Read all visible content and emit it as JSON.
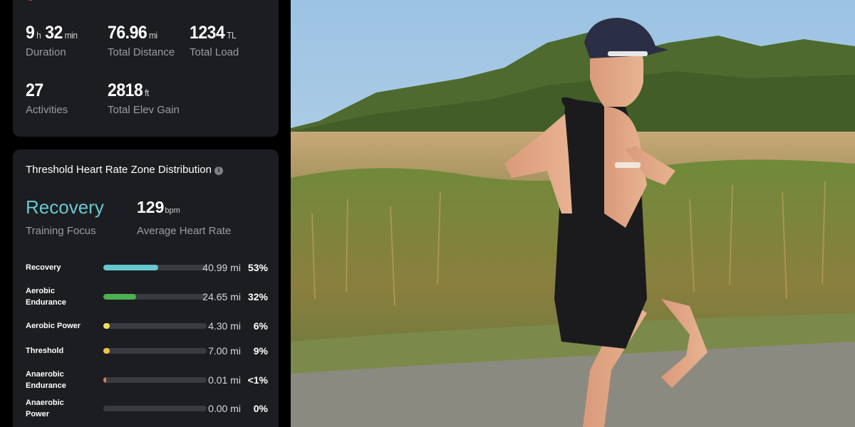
{
  "summary": {
    "duration": {
      "hours": "9",
      "h_unit": "h",
      "minutes": "32",
      "min_unit": "min",
      "label": "Duration"
    },
    "distance": {
      "value": "76.96",
      "unit": "mi",
      "label": "Total Distance"
    },
    "load": {
      "value": "1234",
      "unit": "TL",
      "label": "Total Load"
    },
    "activities": {
      "value": "27",
      "label": "Activities"
    },
    "elevation": {
      "value": "2818",
      "unit": "ft",
      "label": "Total Elev Gain"
    }
  },
  "zones": {
    "title": "Threshold Heart Rate Zone Distribution",
    "info_icon": "info-icon",
    "training_focus": {
      "value": "Recovery",
      "label": "Training Focus"
    },
    "avg_hr": {
      "value": "129",
      "unit": "bpm",
      "label": "Average Heart Rate"
    },
    "rows": [
      {
        "name": "Recovery",
        "distance": "40.99 mi",
        "percent": "53%",
        "fill": 0.53,
        "color": "#67c9d0"
      },
      {
        "name": "Aerobic Endurance",
        "distance": "24.65 mi",
        "percent": "32%",
        "fill": 0.32,
        "color": "#4caf50"
      },
      {
        "name": "Aerobic Power",
        "distance": "4.30 mi",
        "percent": "6%",
        "fill": 0.06,
        "color": "#f0e05a"
      },
      {
        "name": "Threshold",
        "distance": "7.00 mi",
        "percent": "9%",
        "fill": 0.06,
        "color": "#f0c44a"
      },
      {
        "name": "Anaerobic Endurance",
        "distance": "0.01 mi",
        "percent": "<1%",
        "fill": 0.03,
        "color": "#e8774a"
      },
      {
        "name": "Anaerobic Power",
        "distance": "0.00 mi",
        "percent": "0%",
        "fill": 0,
        "color": "#e04a4a"
      }
    ]
  }
}
